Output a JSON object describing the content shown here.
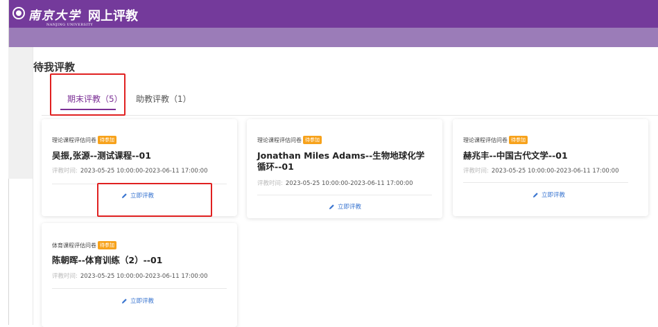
{
  "header": {
    "university_cn": "南京大学",
    "university_en": "NANJING UNIVERSITY",
    "app_title": "网上评教"
  },
  "page": {
    "title": "待我评教"
  },
  "tabs": [
    {
      "label": "期末评教（5）",
      "active": true
    },
    {
      "label": "助教评教（1）",
      "active": false
    }
  ],
  "cards": [
    {
      "type": "理论课程评估问卷",
      "badge": "待参加",
      "title": "吴振,张源--测试课程--01",
      "time_label": "评教时间:",
      "time": "2023-05-25 10:00:00-2023-06-11 17:00:00",
      "action": "立即评教"
    },
    {
      "type": "理论课程评估问卷",
      "badge": "待参加",
      "title": "Jonathan Miles Adams--生物地球化学循环--01",
      "time_label": "评教时间:",
      "time": "2023-05-25 10:00:00-2023-06-11 17:00:00",
      "action": "立即评教"
    },
    {
      "type": "理论课程评估问卷",
      "badge": "待参加",
      "title": "赫兆丰--中国古代文学--01",
      "time_label": "评教时间:",
      "time": "2023-05-25 10:00:00-2023-06-11 17:00:00",
      "action": "立即评教"
    },
    {
      "type": "体育课程评估问卷",
      "badge": "待参加",
      "title": "陈朝晖--体育训练（2）--01",
      "time_label": "评教时间:",
      "time": "2023-05-25 10:00:00-2023-06-11 17:00:00",
      "action": "立即评教"
    }
  ],
  "colors": {
    "header": "#743a9b",
    "header_band": "#9b7cb8",
    "accent": "#7b2f95",
    "badge": "#f7a21b",
    "action_link": "#3b76d0",
    "highlight_box": "#e02020"
  }
}
